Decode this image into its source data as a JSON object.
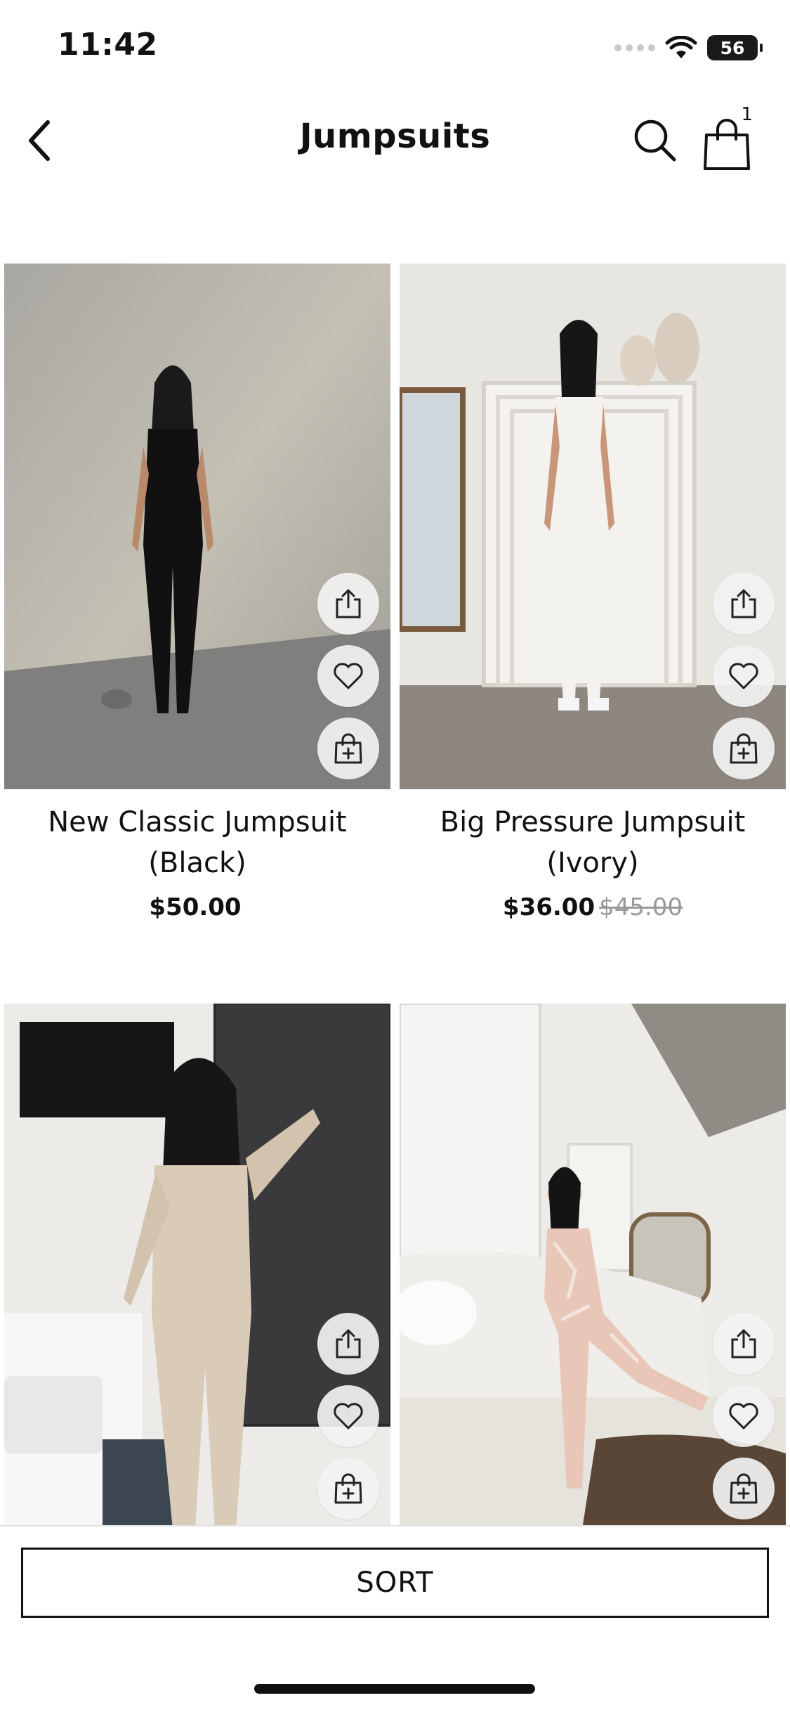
{
  "status_bar": {
    "time": "11:42",
    "battery": "56",
    "icons": [
      "signal-dots-icon",
      "wifi-icon",
      "battery-icon"
    ]
  },
  "header": {
    "title": "Jumpsuits",
    "cart_count": "1",
    "icons": [
      "chevron-left-icon",
      "search-icon",
      "shopping-bag-icon"
    ]
  },
  "products": [
    {
      "name": "New Classic Jumpsuit (Black)",
      "price": "$50.00",
      "original_price": ""
    },
    {
      "name": "Big Pressure Jumpsuit (Ivory)",
      "price": "$36.00",
      "original_price": "$45.00"
    },
    {
      "name": "",
      "price": "",
      "original_price": ""
    },
    {
      "name": "",
      "price": "",
      "original_price": ""
    }
  ],
  "product_actions": [
    "share-icon",
    "heart-icon",
    "add-to-bag-icon"
  ],
  "sort_bar": {
    "label": "SORT"
  },
  "colors": {
    "text": "#111111",
    "strike_price": "#999999",
    "button_bg": "#f2f2f2",
    "border": "#e2e2e2"
  }
}
